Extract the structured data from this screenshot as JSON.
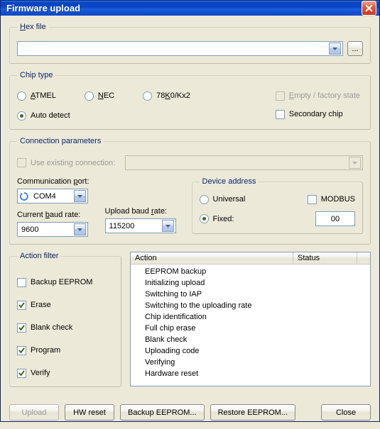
{
  "window": {
    "title": "Firmware upload"
  },
  "hex": {
    "legend": "Hex file",
    "legend_access": "H",
    "value": "",
    "browse": "..."
  },
  "chip": {
    "legend": "Chip type",
    "options": {
      "atmel": {
        "label": "ATMEL",
        "access": "A",
        "checked": false
      },
      "nec": {
        "label": "NEC",
        "access": "N",
        "checked": false
      },
      "k0": {
        "label": "78K0/Kx2",
        "access": "K",
        "checked": false
      },
      "auto": {
        "label": "Auto detect",
        "checked": true
      }
    },
    "empty": {
      "label": "Empty / factory state",
      "access": "E",
      "checked": false,
      "disabled": true
    },
    "secondary": {
      "label": "Secondary chip",
      "checked": false
    }
  },
  "conn": {
    "legend": "Connection parameters",
    "use_existing": {
      "label": "Use existing connection:",
      "checked": false,
      "disabled": true,
      "value": ""
    },
    "port": {
      "label": "Communication port:",
      "access": "p",
      "value": "COM4"
    },
    "curr_baud": {
      "label": "Current baud rate:",
      "access": "b",
      "value": "9600"
    },
    "upl_baud": {
      "label": "Upload baud rate:",
      "access": "r",
      "value": "115200"
    },
    "dev": {
      "legend": "Device address",
      "universal": {
        "label": "Universal",
        "checked": false
      },
      "modbus": {
        "label": "MODBUS",
        "checked": false
      },
      "fixed": {
        "label": "Fixed:",
        "checked": true,
        "value": "00"
      }
    }
  },
  "filter": {
    "legend": "Action filter",
    "backup": {
      "label": "Backup EEPROM",
      "checked": false
    },
    "erase": {
      "label": "Erase",
      "checked": true
    },
    "blank": {
      "label": "Blank check",
      "checked": true
    },
    "program": {
      "label": "Program",
      "checked": true
    },
    "verify": {
      "label": "Verify",
      "checked": true
    }
  },
  "list": {
    "headers": {
      "action": "Action",
      "status": "Status"
    },
    "rows": [
      "EEPROM backup",
      "Initializing upload",
      "Switching to IAP",
      "Switching to the uploading rate",
      "Chip identification",
      "Full chip erase",
      "Blank check",
      "Uploading code",
      "Verifying",
      "Hardware reset"
    ]
  },
  "buttons": {
    "upload": "Upload",
    "hwreset": "HW reset",
    "backup": "Backup EEPROM...",
    "restore": "Restore EEPROM...",
    "close": "Close"
  }
}
